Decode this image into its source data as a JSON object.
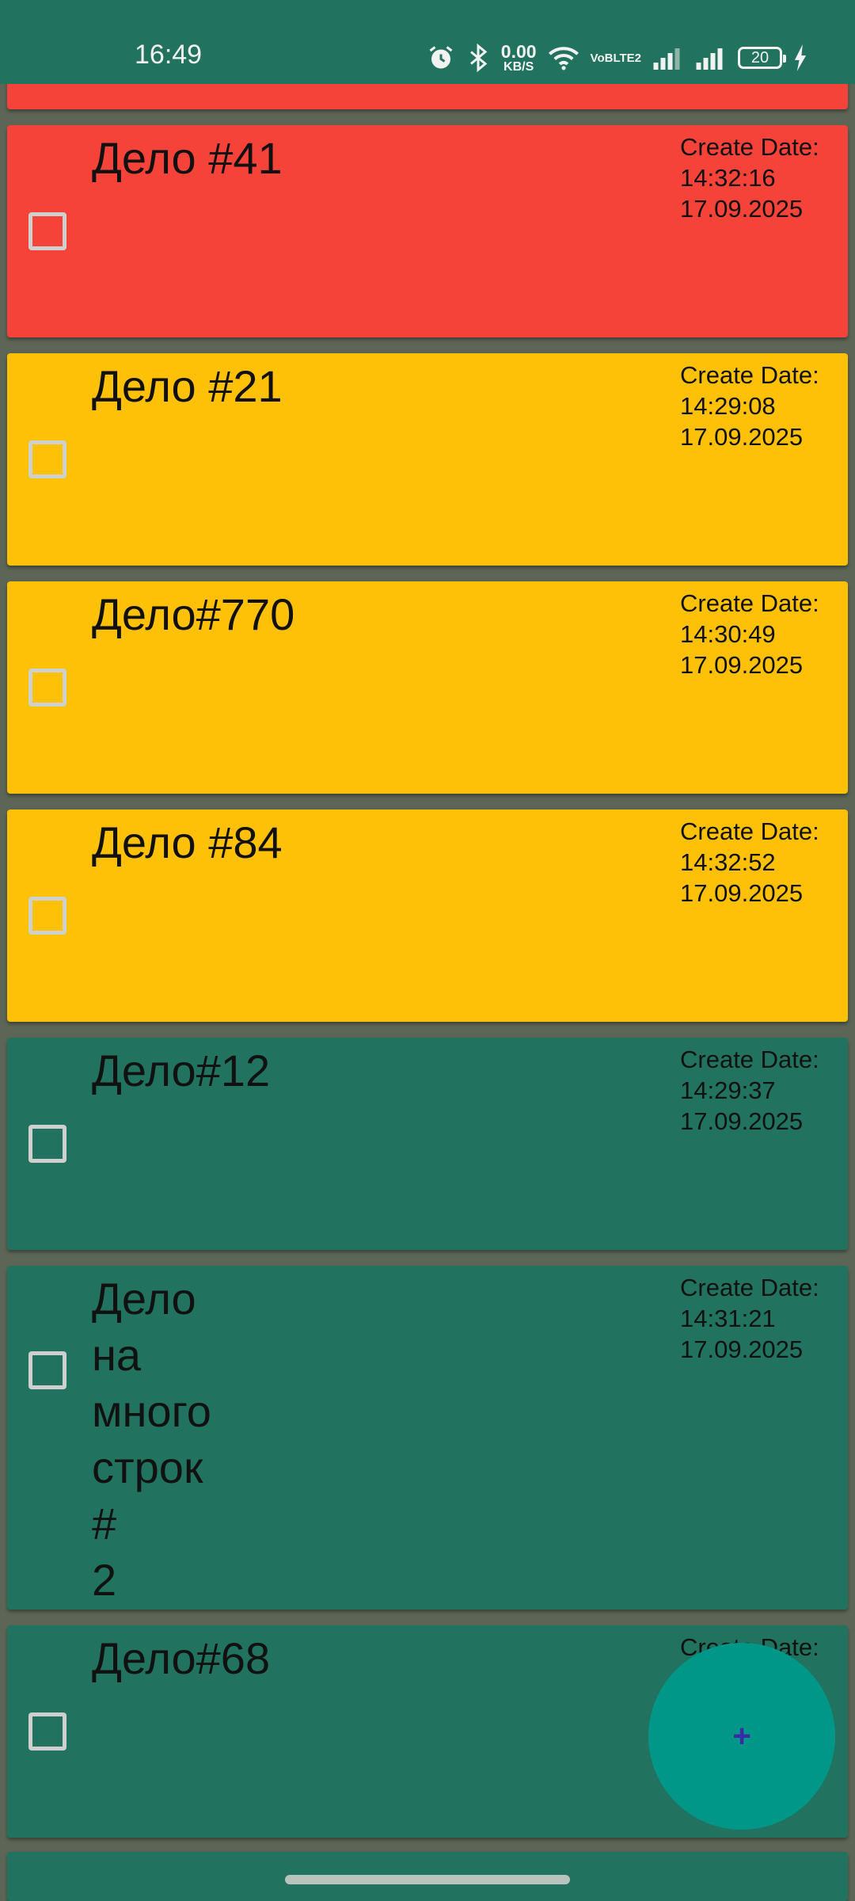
{
  "status_bar": {
    "time": "16:49",
    "net_speed_value": "0.00",
    "net_speed_unit": "KB/S",
    "volte_top": "VoB",
    "volte_bottom": "LTE2",
    "battery_level": "20",
    "icons": [
      "alarm-icon",
      "bluetooth-icon",
      "wifi-icon",
      "signal-icon",
      "signal-icon",
      "battery-icon",
      "charging-icon"
    ]
  },
  "tasks": [
    {
      "title": "Дело #41",
      "date_label": "Create Date:",
      "time": "14:32:16",
      "date": "17.09.2025",
      "color": "#f5433a"
    },
    {
      "title": "Дело #21",
      "date_label": "Create Date:",
      "time": "14:29:08",
      "date": "17.09.2025",
      "color": "#fec107"
    },
    {
      "title": "Дело#770",
      "date_label": "Create Date:",
      "time": "14:30:49",
      "date": "17.09.2025",
      "color": "#fec107"
    },
    {
      "title": "Дело #84",
      "date_label": "Create Date:",
      "time": "14:32:52",
      "date": "17.09.2025",
      "color": "#fec107"
    },
    {
      "title": "Дело#12",
      "date_label": "Create Date:",
      "time": "14:29:37",
      "date": "17.09.2025",
      "color": "#217360"
    },
    {
      "title_lines": [
        "Дело",
        "на",
        "много",
        "строк",
        "#",
        "2"
      ],
      "date_label": "Create Date:",
      "time": "14:31:21",
      "date": "17.09.2025",
      "color": "#217360"
    },
    {
      "title": "Дело#68",
      "date_label": "Create Date:",
      "color": "#217360"
    }
  ],
  "fab": {
    "label": "+",
    "color": "#009688"
  },
  "colors": {
    "background": "#5d6656",
    "status_bar": "#217360",
    "red": "#f5433a",
    "yellow": "#fec107",
    "green": "#217360"
  }
}
